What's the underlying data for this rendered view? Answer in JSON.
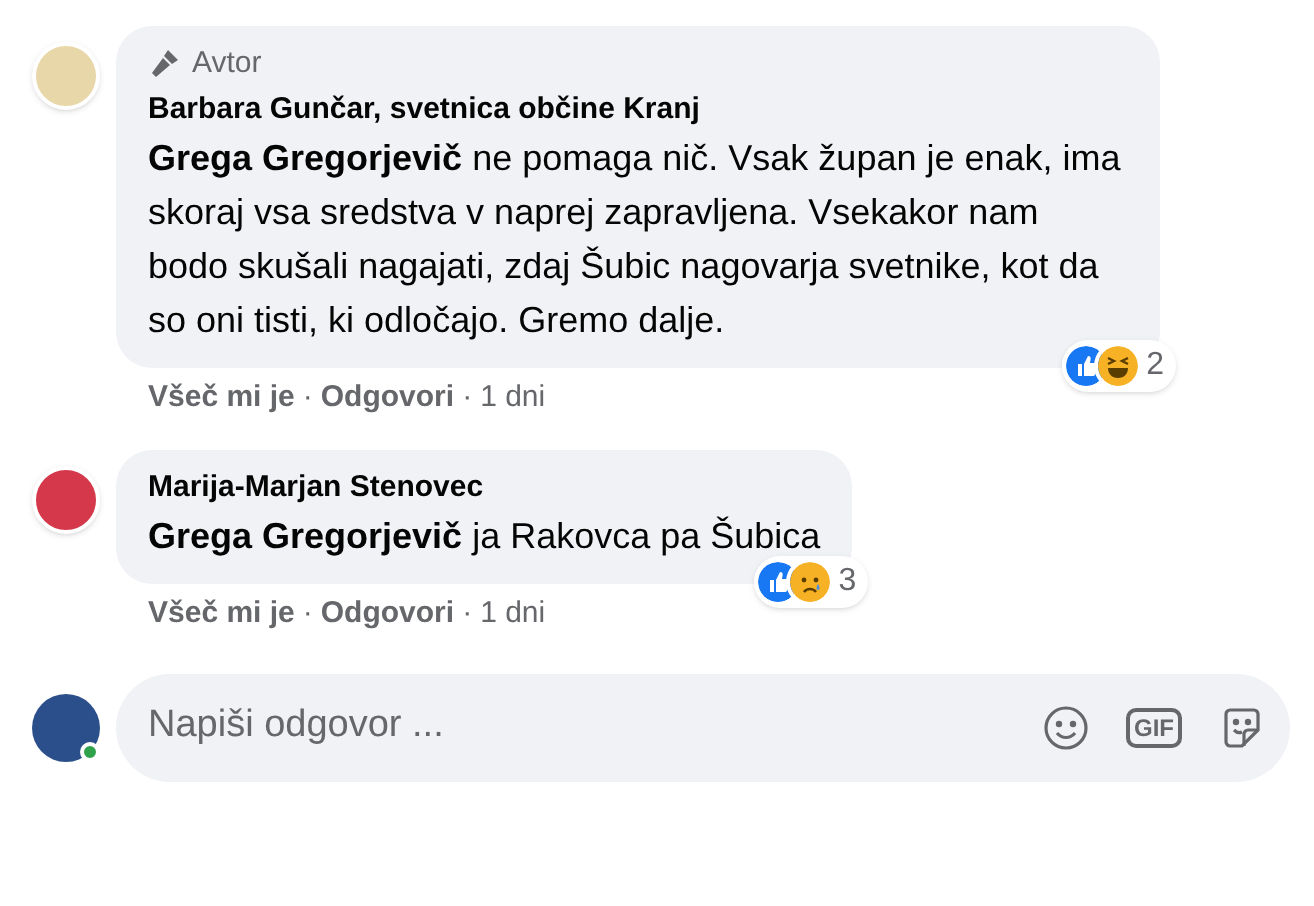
{
  "comments": [
    {
      "badge": "Avtor",
      "author": "Barbara Gunčar, svetnica občine Kranj",
      "mention": "Grega Gregorjevič",
      "text": " ne pomaga nič. Vsak župan je enak, ima skoraj vsa sredstva v naprej zapravljena. Vsekakor nam bodo skušali nagajati, zdaj Šubic nagovarja svetnike, kot da so oni tisti, ki odločajo. Gremo dalje.",
      "reactions": [
        {
          "kind": "like"
        },
        {
          "kind": "haha"
        }
      ],
      "reaction_count": "2",
      "actions": [
        "Všeč mi je",
        "Odgovori"
      ],
      "separator": "·",
      "time": "1 dni"
    },
    {
      "author": "Marija-Marjan Stenovec",
      "mention": "Grega Gregorjevič",
      "text": " ja Rakovca pa Šubica",
      "reactions": [
        {
          "kind": "like"
        },
        {
          "kind": "sad"
        }
      ],
      "reaction_count": "3",
      "actions": [
        "Všeč mi je",
        "Odgovori"
      ],
      "separator": "·",
      "time": "1 dni"
    }
  ],
  "reply_box": {
    "placeholder": "Napiši odgovor ...",
    "online": true,
    "gif_label": "GIF"
  }
}
